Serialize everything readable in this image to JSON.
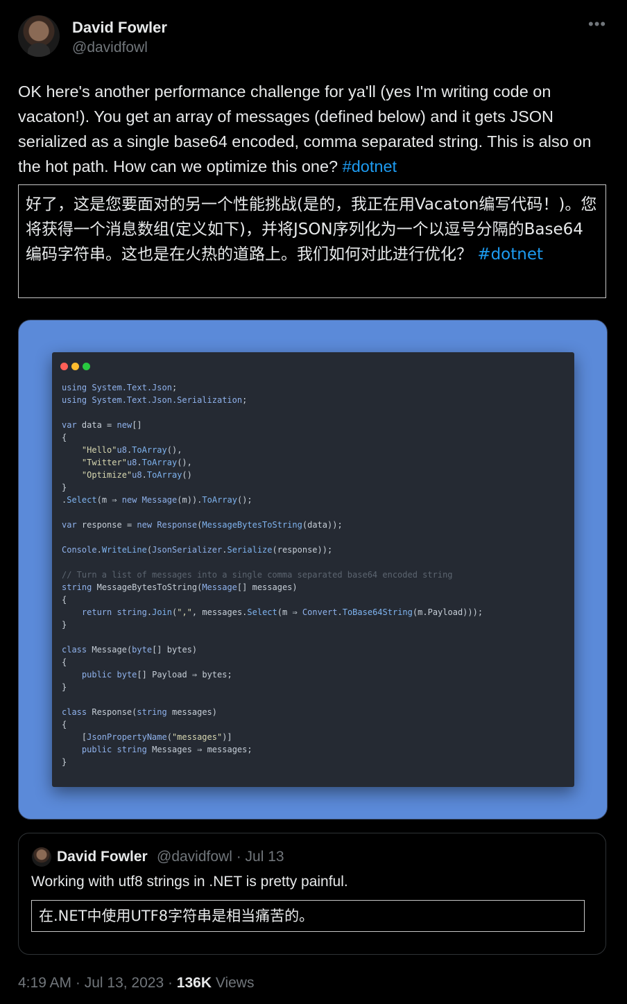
{
  "author": {
    "name": "David Fowler",
    "handle": "@davidfowl"
  },
  "tweet": {
    "text": "OK here's another performance challenge for ya'll (yes I'm writing code on vacaton!). You get an array of messages (defined below) and it gets JSON serialized as a single base64 encoded, comma separated string. This is also on the hot path. How can we optimize this one? ",
    "hashtag": "#dotnet",
    "translation": "好了，这是您要面对的另一个性能挑战(是的，我正在用Vacaton编写代码！)。您将获得一个消息数组(定义如下)，并将JSON序列化为一个以逗号分隔的Base64编码字符串。这也是在火热的道路上。我们如何对此进行优化？ ",
    "translation_hashtag": "#dotnet"
  },
  "window_dots": {
    "red": "#ff5f57",
    "yellow": "#febc2e",
    "green": "#28c840"
  },
  "quote": {
    "name": "David Fowler",
    "meta": "@davidfowl · Jul 13",
    "text": "Working with utf8 strings in .NET is pretty painful.",
    "translation": "在.NET中使用UTF8字符串是相当痛苦的。"
  },
  "footer": {
    "time": "4:19 AM · Jul 13, 2023 · ",
    "views_count": "136K",
    "views_label": " Views"
  },
  "colors": {
    "background": "#000000",
    "hashtag": "#1d9bf0",
    "muted": "#71767b",
    "media_bg": "#5b8ad9",
    "code_bg": "#252a33"
  }
}
